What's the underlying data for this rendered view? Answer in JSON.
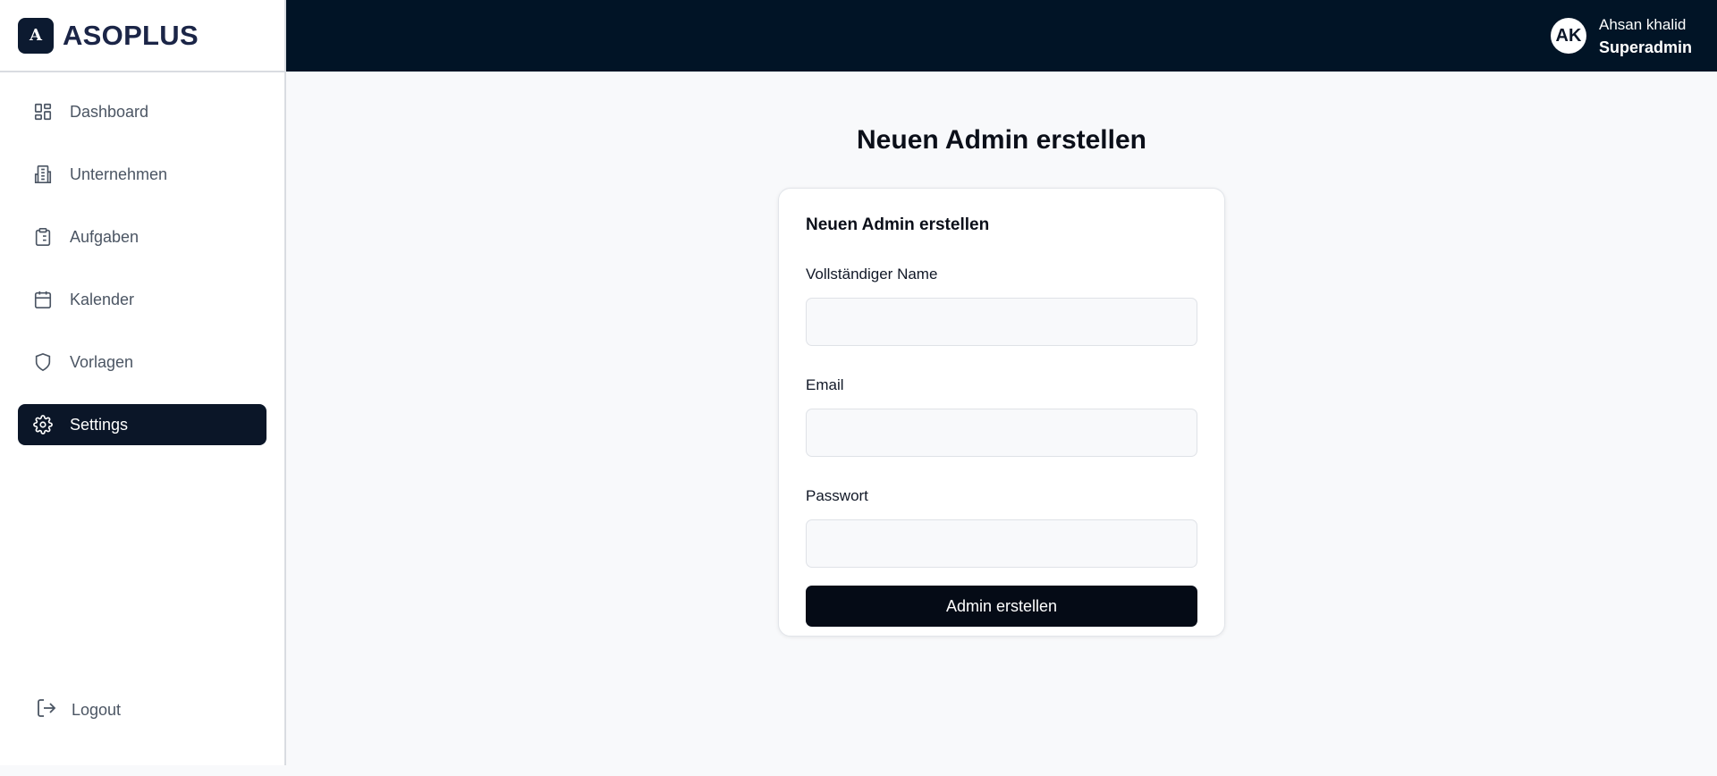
{
  "brand": {
    "mark": "A",
    "name": "ASOPLUS"
  },
  "sidebar": {
    "items": [
      {
        "label": "Dashboard",
        "icon": "dashboard-icon"
      },
      {
        "label": "Unternehmen",
        "icon": "building-icon"
      },
      {
        "label": "Aufgaben",
        "icon": "clipboard-icon"
      },
      {
        "label": "Kalender",
        "icon": "calendar-icon"
      },
      {
        "label": "Vorlagen",
        "icon": "shield-icon"
      },
      {
        "label": "Settings",
        "icon": "gear-icon",
        "active": true
      }
    ],
    "logout_label": "Logout"
  },
  "header": {
    "avatar_initials": "AK",
    "user_name": "Ahsan khalid",
    "user_role": "Superadmin"
  },
  "main": {
    "page_title": "Neuen Admin erstellen",
    "form": {
      "title": "Neuen Admin erstellen",
      "name_label": "Vollständiger Name",
      "name_value": "",
      "email_label": "Email",
      "email_value": "",
      "password_label": "Passwort",
      "password_value": "",
      "submit_label": "Admin erstellen"
    }
  },
  "colors": {
    "header_bg": "#011426",
    "active_nav_bg": "#0b1628",
    "button_bg": "#050b16",
    "page_bg": "#f8f9fb"
  }
}
